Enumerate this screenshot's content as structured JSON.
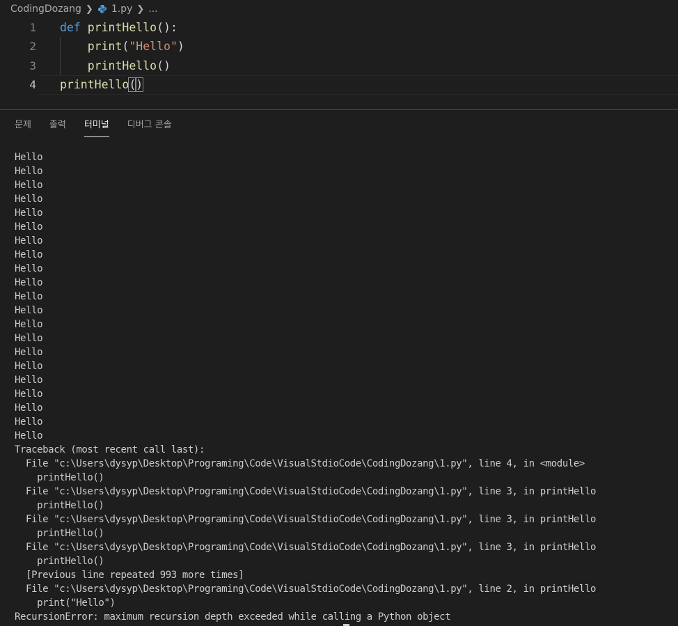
{
  "breadcrumb": {
    "folder": "CodingDozang",
    "file": "1.py",
    "more": "..."
  },
  "editor": {
    "line_numbers": [
      "1",
      "2",
      "3",
      "4"
    ],
    "line1": {
      "kw": "def",
      "fn": "printHello",
      "punct": "():"
    },
    "line2": {
      "fn": "print",
      "open": "(",
      "str": "\"Hello\"",
      "close": ")"
    },
    "line3": {
      "fn": "printHello",
      "punct": "()"
    },
    "line4": {
      "fn": "printHello",
      "open": "(",
      "close": ")"
    }
  },
  "panel": {
    "tabs": [
      {
        "label": "문제"
      },
      {
        "label": "출력"
      },
      {
        "label": "터미널"
      },
      {
        "label": "디버그 콘솔"
      }
    ],
    "active_tab": "터미널"
  },
  "terminal": {
    "lines": [
      "Hello",
      "Hello",
      "Hello",
      "Hello",
      "Hello",
      "Hello",
      "Hello",
      "Hello",
      "Hello",
      "Hello",
      "Hello",
      "Hello",
      "Hello",
      "Hello",
      "Hello",
      "Hello",
      "Hello",
      "Hello",
      "Hello",
      "Hello",
      "Hello",
      "Traceback (most recent call last):",
      "  File \"c:\\Users\\dysyp\\Desktop\\Programing\\Code\\VisualStdioCode\\CodingDozang\\1.py\", line 4, in <module>",
      "    printHello()",
      "  File \"c:\\Users\\dysyp\\Desktop\\Programing\\Code\\VisualStdioCode\\CodingDozang\\1.py\", line 3, in printHello",
      "    printHello()",
      "  File \"c:\\Users\\dysyp\\Desktop\\Programing\\Code\\VisualStdioCode\\CodingDozang\\1.py\", line 3, in printHello",
      "    printHello()",
      "  File \"c:\\Users\\dysyp\\Desktop\\Programing\\Code\\VisualStdioCode\\CodingDozang\\1.py\", line 3, in printHello",
      "    printHello()",
      "  [Previous line repeated 993 more times]",
      "  File \"c:\\Users\\dysyp\\Desktop\\Programing\\Code\\VisualStdioCode\\CodingDozang\\1.py\", line 2, in printHello",
      "    print(\"Hello\")",
      "RecursionError: maximum recursion depth exceeded while calling a Python object"
    ]
  },
  "colors": {
    "background": "#1e1e1e",
    "keyword": "#569cd6",
    "function": "#dcdcaa",
    "string": "#ce9178"
  },
  "icons": {
    "file_icon": "python-icon",
    "separator": "chevron-right-icon"
  }
}
